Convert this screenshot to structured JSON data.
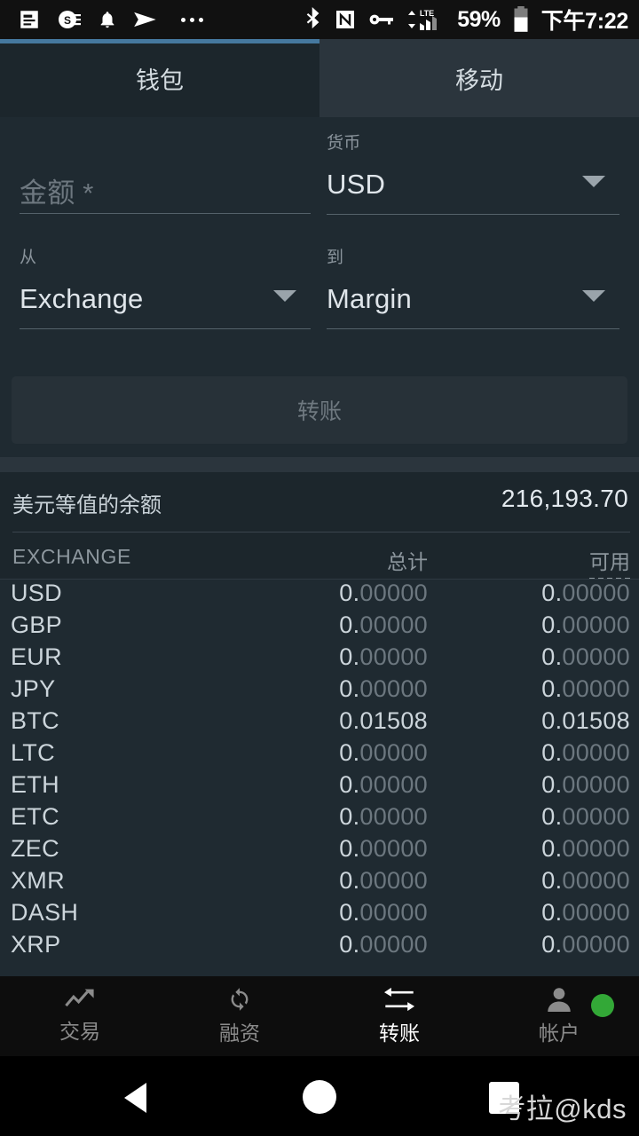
{
  "statusbar": {
    "icons_left": [
      "article-icon",
      "se-badge-icon",
      "bell-icon",
      "send-icon",
      "overflow-dots-icon"
    ],
    "icons_right": [
      "bluetooth-icon",
      "nfc-icon",
      "vpn-key-icon",
      "lte-signal-icon"
    ],
    "battery_percent": "59%",
    "time": "下午7:22"
  },
  "tabs": {
    "items": [
      {
        "label": "钱包",
        "selected": true
      },
      {
        "label": "移动",
        "selected": false
      }
    ],
    "indicator_color": "#45789f"
  },
  "form": {
    "amount": {
      "label": "",
      "placeholder": "金额 *",
      "value": ""
    },
    "currency": {
      "label": "货币",
      "value": "USD"
    },
    "from": {
      "label": "从",
      "value": "Exchange"
    },
    "to": {
      "label": "到",
      "value": "Margin"
    },
    "submit_label": "转账"
  },
  "balance": {
    "label": "美元等值的余额",
    "value": "216,193.70"
  },
  "table": {
    "headers": {
      "name": "EXCHANGE",
      "total": "总计",
      "available": "可用"
    },
    "rows": [
      {
        "currency": "USD",
        "total": "0.00000",
        "available": "0.00000",
        "zero": true
      },
      {
        "currency": "GBP",
        "total": "0.00000",
        "available": "0.00000",
        "zero": true
      },
      {
        "currency": "EUR",
        "total": "0.00000",
        "available": "0.00000",
        "zero": true
      },
      {
        "currency": "JPY",
        "total": "0.00000",
        "available": "0.00000",
        "zero": true
      },
      {
        "currency": "BTC",
        "total": "0.01508",
        "available": "0.01508",
        "zero": false
      },
      {
        "currency": "LTC",
        "total": "0.00000",
        "available": "0.00000",
        "zero": true
      },
      {
        "currency": "ETH",
        "total": "0.00000",
        "available": "0.00000",
        "zero": true
      },
      {
        "currency": "ETC",
        "total": "0.00000",
        "available": "0.00000",
        "zero": true
      },
      {
        "currency": "ZEC",
        "total": "0.00000",
        "available": "0.00000",
        "zero": true
      },
      {
        "currency": "XMR",
        "total": "0.00000",
        "available": "0.00000",
        "zero": true
      },
      {
        "currency": "DASH",
        "total": "0.00000",
        "available": "0.00000",
        "zero": true
      },
      {
        "currency": "XRP",
        "total": "0.00000",
        "available": "0.00000",
        "zero": true
      }
    ]
  },
  "bottomnav": {
    "items": [
      {
        "label": "交易",
        "icon": "trending-up-icon",
        "active": false
      },
      {
        "label": "融资",
        "icon": "refresh-icon",
        "active": false
      },
      {
        "label": "转账",
        "icon": "transfer-arrows-icon",
        "active": true
      },
      {
        "label": "帐户",
        "icon": "person-icon",
        "active": false
      }
    ],
    "status_dot_color": "#33a837"
  },
  "androidnav": {
    "back": "back-icon",
    "home": "home-icon",
    "recents": "recents-icon"
  },
  "watermark": "考拉@kds"
}
